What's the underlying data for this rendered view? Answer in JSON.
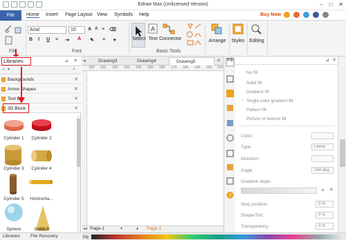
{
  "window": {
    "title": "Edraw Max (Unlicensed Version)",
    "window_buttons": [
      "–",
      "□",
      "✕"
    ]
  },
  "menubar": {
    "file_label": "File",
    "items": [
      "Home",
      "Insert",
      "Page Layout",
      "View",
      "Symbols",
      "Help"
    ],
    "buy_now": "Buy Now"
  },
  "ribbon": {
    "font_name": "Arial",
    "font_size": "10",
    "group_file": "File",
    "group_font": "Font",
    "group_basic_tools": "Basic Tools",
    "select_label": "Select",
    "text_label": "Text",
    "connector_label": "Connector",
    "arrange_label": "Arrange",
    "styles_label": "Styles",
    "editing_label": "Editing",
    "format_buttons": [
      "B",
      "I",
      "U"
    ]
  },
  "libraries": {
    "title": "Libraries",
    "categories": [
      "Backgrounds",
      "Arrow Shapes",
      "Text Box",
      "3D Block"
    ],
    "shapes": [
      "Cylinder 1",
      "Cylinder 2",
      "Cylinder 3",
      "Cylinder 4",
      "Cylinder 5",
      "Horizonta...",
      "Sphere",
      "Cone 3"
    ]
  },
  "doc_tabs": [
    "Drawing3",
    "Drawing4",
    "Drawing5"
  ],
  "ruler_labels": [
    "100",
    "110",
    "120",
    "130",
    "140",
    "150",
    "160",
    "170",
    "180",
    "190",
    "200",
    "210"
  ],
  "page_tabs": {
    "page": "Page-1",
    "active_page": "Page-1"
  },
  "fill_panel": {
    "title": "Fill",
    "options": [
      "No fill",
      "Solid fill",
      "Gradient fill",
      "Single color gradient fill",
      "Pattern fill",
      "Picture or texture fill"
    ],
    "color_label": "Color:",
    "type_label": "Type:",
    "type_value": "Linear",
    "direction_label": "Direction:",
    "angle_label": "Angle:",
    "angle_value": "164 deg",
    "gradient_stops_label": "Gradient stops:",
    "stop_position_label": "Stop position:",
    "stop_position_value": "0 %",
    "shade_tint_label": "Shade/Tint:",
    "shade_tint_value": "0 %",
    "transparency_label": "Transparency:",
    "transparency_value": "0 %"
  },
  "bottom_tabs": {
    "libraries": "Libraries",
    "file_recovery": "File Recovery"
  },
  "colors": {
    "file_blue": "#3b64a8",
    "highlight_red": "#e02020",
    "buy_now": "#d9480f",
    "accent_orange": "#e8a33a"
  }
}
